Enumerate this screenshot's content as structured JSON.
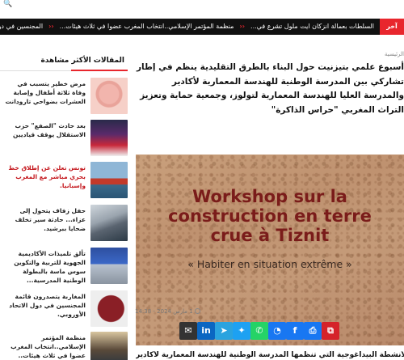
{
  "topbar": {
    "search_label": "🔍"
  },
  "ticker": {
    "label": "آخر الأخبار",
    "items": [
      "السلطات بعمالة انزكان ايت ملول تشرع في...",
      "منظمة المؤتمر الإسلامي..انتخاب المغرب عضوا في ثلاث هيئات...",
      "المجنسين في دول الاتحاد الأوروبي"
    ]
  },
  "article": {
    "breadcrumb": "الرئيسية",
    "title": "أسبوع علمي بتيزنيت حول البناء بالطرق التقليدية ينظم في إطار تشاركي بين المدرسة الوطنية للهندسة المعمارية لأكادير والمدرسة العليا للهندسة المعمارية لتولوز، وجمعية حماية وتعزيز التراث المغربي \"حراس الذاكرة\"",
    "image_heading_1": "Workshop sur la",
    "image_heading_2": "construction en terre",
    "image_heading_3": "crue à Tiznit",
    "image_subheading": "« Habiter en situation extrême »",
    "date": "1 مارس 2024 - 14:38",
    "intro": "في إطار الأنشطة البيداغوجية التي تنظمها المدرسة الوطنية للهندسة المعمارية لأكادير،"
  },
  "share": [
    {
      "icon": "copy-icon",
      "glyph": "⧉",
      "color": "#d5232a"
    },
    {
      "icon": "print-icon",
      "glyph": "⎙",
      "color": "#1877f2"
    },
    {
      "icon": "facebook-icon",
      "glyph": "f",
      "color": "#1877f2"
    },
    {
      "icon": "messenger-icon",
      "glyph": "◔",
      "color": "#1877f2"
    },
    {
      "icon": "whatsapp-icon",
      "glyph": "✆",
      "color": "#25d366"
    },
    {
      "icon": "twitter-icon",
      "glyph": "✦",
      "color": "#1da1f2"
    },
    {
      "icon": "telegram-icon",
      "glyph": "➤",
      "color": "#2aa3df"
    },
    {
      "icon": "linkedin-icon",
      "glyph": "in",
      "color": "#0a66c2"
    },
    {
      "icon": "email-icon",
      "glyph": "✉",
      "color": "#333333"
    }
  ],
  "sidebar": {
    "heading": "المقالات الأكثر مشاهدة",
    "items": [
      {
        "text": "مرض خطير يتسبب في وفاة ثلاثة أطفال وإصابة العشرات بضواحي تارودانت",
        "thumb": "baby"
      },
      {
        "text": "بعد حادث \"الصفع\" حزب الاستقلال يوقف قياديين",
        "thumb": "stage"
      },
      {
        "text": "تونس تعلن عن إطلاق خط بحري مباشر مع المغرب وإسبانيا.",
        "thumb": "ship",
        "red": true
      },
      {
        "text": "حفل زفاف يتحول إلى عزاء... حادثة سير تخلف ضحايا ببرشيد.",
        "thumb": "crash"
      },
      {
        "text": "تألق تلميذات الأكاديمية الجهوية للتربية والتكوين سوس ماسة بالبطولة الوطنية المدرسية...",
        "thumb": "team"
      },
      {
        "text": "المغاربة يتصدرون قائمة المجنسين في دول الاتحاد الأوروبي.",
        "thumb": "passport"
      },
      {
        "text": "منظمة المؤتمر الإسلامي..انتخاب المغرب عضوا في ثلاث هيئات..",
        "thumb": "meeting"
      }
    ]
  }
}
